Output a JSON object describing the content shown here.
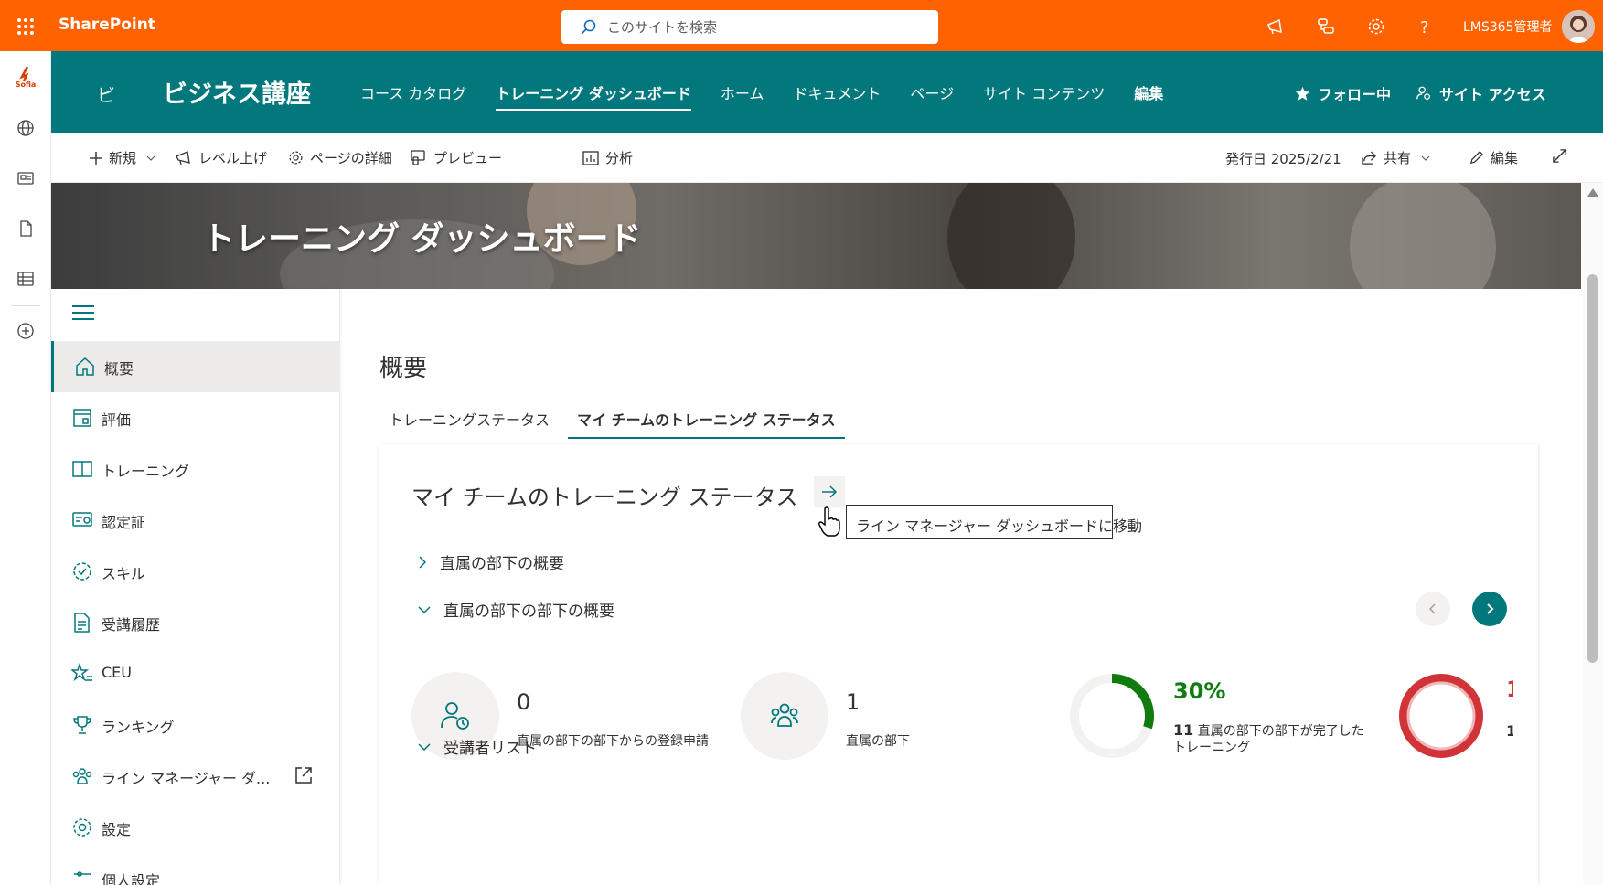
{
  "suitebar": {
    "brand": "SharePoint",
    "search_placeholder": "このサイトを検索",
    "user_name": "LMS365管理者"
  },
  "site": {
    "logo_char": "ビ",
    "title": "ビジネス講座",
    "nav": [
      {
        "label": "コース カタログ"
      },
      {
        "label": "トレーニング ダッシュボード"
      },
      {
        "label": "ホーム"
      },
      {
        "label": "ドキュメント"
      },
      {
        "label": "ページ"
      },
      {
        "label": "サイト コンテンツ"
      },
      {
        "label": "編集"
      }
    ],
    "follow_label": "フォロー中",
    "access_label": "サイト アクセス"
  },
  "commandbar": {
    "new_label": "新規",
    "promote_label": "レベル上げ",
    "details_label": "ページの詳細",
    "preview_label": "プレビュー",
    "analytics_label": "分析",
    "published": "発行日 2025/2/21",
    "share_label": "共有",
    "edit_label": "編集"
  },
  "hero": {
    "title": "トレーニング ダッシュボード"
  },
  "leftnav": {
    "items": [
      {
        "label": "概要"
      },
      {
        "label": "評価"
      },
      {
        "label": "トレーニング"
      },
      {
        "label": "認定証"
      },
      {
        "label": "スキル"
      },
      {
        "label": "受講履歴"
      },
      {
        "label": "CEU"
      },
      {
        "label": "ランキング"
      },
      {
        "label": "ライン マネージャー ダ..."
      },
      {
        "label": "設定"
      },
      {
        "label": "個人設定"
      }
    ]
  },
  "main": {
    "heading": "概要",
    "tabs": [
      {
        "label": "トレーニングステータス"
      },
      {
        "label": "マイ チームのトレーニング ステータス"
      }
    ],
    "card": {
      "title": "マイ チームのトレーニング ステータス",
      "tooltip": "ライン マネージャー ダッシュボードに移動",
      "sections": [
        {
          "label": "直属の部下の概要"
        },
        {
          "label": "直属の部下の部下の概要"
        },
        {
          "label": "受講者リスト"
        }
      ],
      "stats": [
        {
          "value": "0",
          "label": "直属の部下の部下からの登録申請"
        },
        {
          "value": "1",
          "label": "直属の部下"
        }
      ],
      "completion": {
        "percent_text": "30%",
        "percent": 30,
        "count": "11",
        "label": "直属の部下の部下が完了したトレーニング",
        "color": "#107c10"
      },
      "second_donut": {
        "color": "#d13438"
      }
    }
  },
  "colors": {
    "suitebar": "#ff6200",
    "theme": "#03787c"
  }
}
